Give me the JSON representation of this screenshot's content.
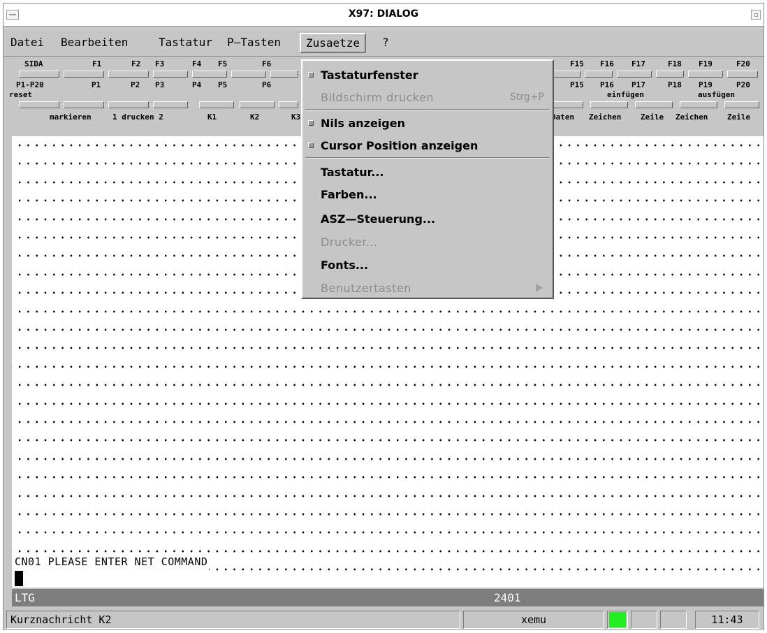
{
  "window": {
    "title": "X97: DIALOG"
  },
  "menubar": {
    "items": [
      {
        "label": "Datei"
      },
      {
        "label": "Bearbeiten"
      },
      {
        "label": "Tastatur"
      },
      {
        "label": "P—Tasten"
      },
      {
        "label": "Zusaetze"
      },
      {
        "label": "?"
      }
    ]
  },
  "fkeys": {
    "row1": [
      "SIDA",
      "F1",
      "F2",
      "F3",
      "F4",
      "F5",
      "F6",
      "F15",
      "F16",
      "F17",
      "F18",
      "F19",
      "F20"
    ],
    "row2": [
      "P1-P20",
      "P1",
      "P2",
      "P3",
      "P4",
      "P5",
      "P6",
      "P15",
      "P16",
      "P17",
      "P18",
      "P19",
      "P20"
    ],
    "row2b": [
      "reset",
      "einfügen",
      "ausfügen"
    ],
    "row3": [
      "markieren",
      "1 drucken 2",
      "K1",
      "K2",
      "K3",
      "Daten",
      "Zeichen",
      "Zeile",
      "Zeichen",
      "Zeile"
    ]
  },
  "dropdown": {
    "items": [
      {
        "label": "Tastaturfenster",
        "checked": true
      },
      {
        "label": "Bildschirm drucken",
        "accel": "Strg+P",
        "disabled": true
      },
      {
        "label": "Nils anzeigen",
        "checked": true
      },
      {
        "label": "Cursor Position anzeigen",
        "checked": true
      },
      {
        "label": "Tastatur..."
      },
      {
        "label": "Farben..."
      },
      {
        "label": "ASZ—Steuerung..."
      },
      {
        "label": "Drucker...",
        "disabled": true
      },
      {
        "label": "Fonts..."
      },
      {
        "label": "Benutzertasten",
        "disabled": true,
        "submenu": true
      }
    ]
  },
  "terminal": {
    "message": "CN01 PLEASE ENTER NET COMMAND"
  },
  "statusline": {
    "left": "LTG",
    "center": "2401"
  },
  "bottombar": {
    "message": "Kurznachricht K2",
    "host": "xemu",
    "indicator_color": "#22ee22",
    "time": "11:43"
  }
}
